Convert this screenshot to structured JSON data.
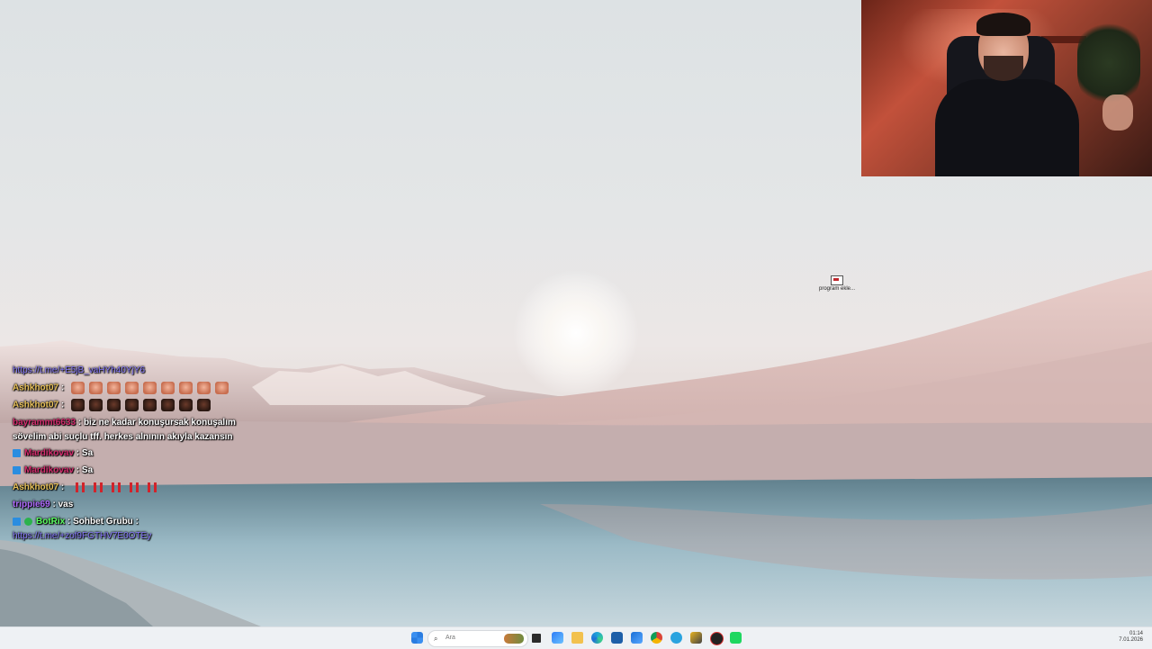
{
  "desktop": {
    "icon_label": "program ekle..."
  },
  "chat": [
    {
      "type": "link",
      "link": "https://t.me/+E5jB_vaHYh40YjY6"
    },
    {
      "type": "emotes",
      "name": "Ashkhot07",
      "name_color": "#e8c15a",
      "emote_style": "e1",
      "emote_count": 9
    },
    {
      "type": "emotes",
      "name": "Ashkhot07",
      "name_color": "#e8c15a",
      "emote_style": "e2",
      "emote_count": 8
    },
    {
      "type": "text",
      "name": "bayrammt6633",
      "name_color": "#d42c6d",
      "text": "biz ne kadar konuşursak konuşalım",
      "text2": "sövelim abi suçlu tff. herkes alnının akıyla kazansın"
    },
    {
      "type": "badge_text",
      "badge": "prime",
      "name": "Mardikovav",
      "name_color": "#d42c6d",
      "text": "Sa"
    },
    {
      "type": "badge_text",
      "badge": "prime",
      "name": "Mardikovav",
      "name_color": "#d42c6d",
      "text": "Sa"
    },
    {
      "type": "emotes",
      "name": "Ashkhot07",
      "name_color": "#e8c15a",
      "emote_style": "e3",
      "emote_count": 5
    },
    {
      "type": "text",
      "name": "trippie69",
      "name_color": "#b06cff",
      "text": "vas"
    },
    {
      "type": "bot",
      "name": "BotRix",
      "name_color": "#5cff62",
      "text": "Sohbet Grubu :",
      "link": "https://t.me/+zof9FGTHV7E0OTEy"
    }
  ],
  "taskbar": {
    "search_placeholder": "Ara",
    "icons": [
      "start-icon",
      "search-icon",
      "task-view-icon",
      "widgets-icon",
      "file-explorer-icon",
      "edge-icon",
      "store-icon",
      "mail-icon",
      "chrome-icon",
      "telegram-icon",
      "winamp-icon",
      "obs-icon",
      "spotify-icon"
    ],
    "clock_time": "01:14",
    "clock_date": "7.01.2026"
  }
}
